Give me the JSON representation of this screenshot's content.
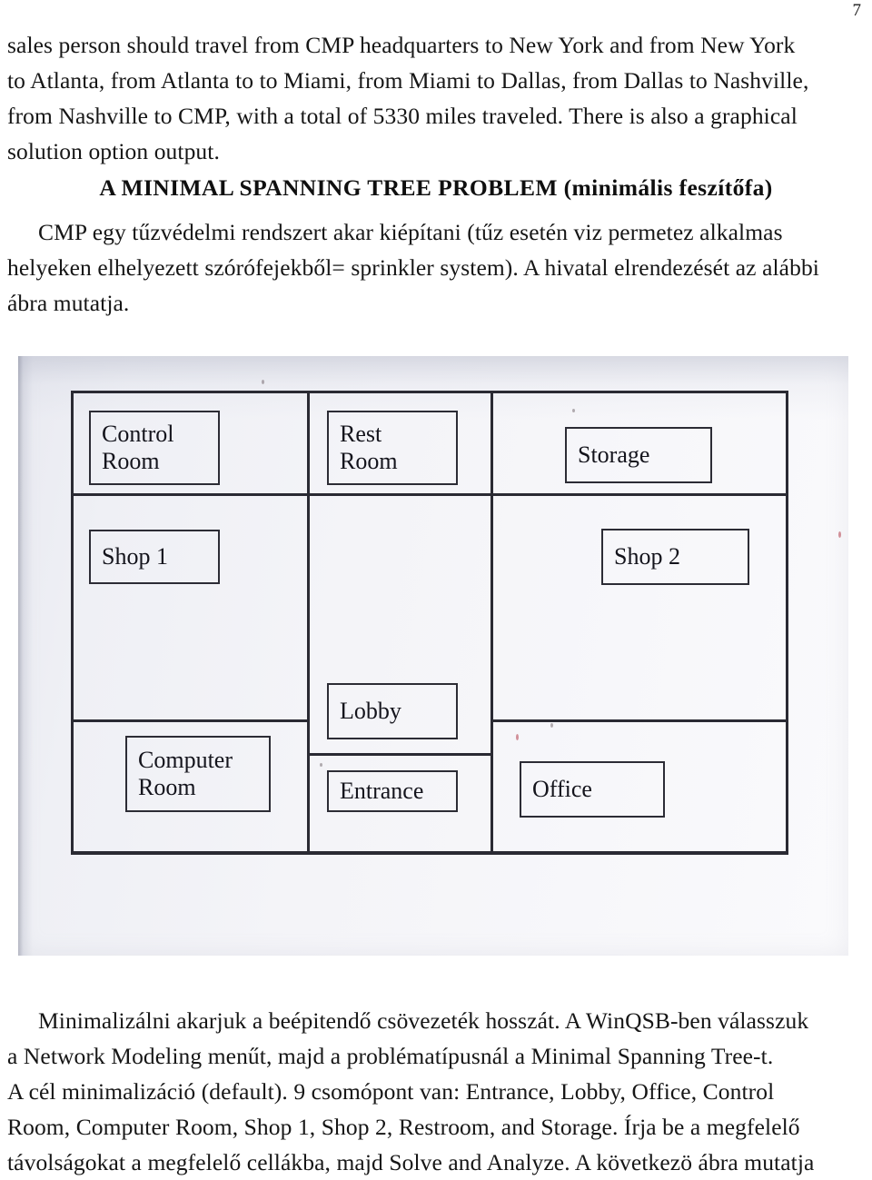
{
  "page": {
    "number": "7"
  },
  "paragraph_top": {
    "lines": [
      "sales person should travel from CMP headquarters to New York and from New York",
      "to Atlanta, from Atlanta to to Miami, from Miami to Dallas, from Dallas to Nashville,",
      "from Nashville to CMP, with a total of 5330 miles traveled. There is also a graphical",
      "solution option output."
    ]
  },
  "heading": {
    "text": "A MINIMAL SPANNING TREE PROBLEM (minimális feszítőfa)"
  },
  "paragraph_mid": {
    "lines": [
      "CMP egy tűzvédelmi rendszert akar kiépítani (tűz esetén viz permetez alkalmas",
      "helyeken elhelyezett szórófejekből= sprinkler system). A hivatal elrendezését az alábbi",
      "ábra mutatja."
    ]
  },
  "figure": {
    "caption": "",
    "floor_plan": {
      "rooms": [
        {
          "name": "control-room",
          "label": "Control\nRoom"
        },
        {
          "name": "rest-room",
          "label": "Rest\nRoom"
        },
        {
          "name": "storage",
          "label": "Storage"
        },
        {
          "name": "shop-1",
          "label": "Shop 1"
        },
        {
          "name": "shop-2",
          "label": "Shop 2"
        },
        {
          "name": "lobby",
          "label": "Lobby"
        },
        {
          "name": "computer-room",
          "label": "Computer\nRoom"
        },
        {
          "name": "entrance",
          "label": "Entrance"
        },
        {
          "name": "office",
          "label": "Office"
        }
      ]
    }
  },
  "paragraph_bottom": {
    "lines": [
      "Minimalizálni akarjuk a beépitendő csövezeték hosszát. A WinQSB-ben válasszuk",
      "a Network Modeling menűt, majd a problématípusnál a Minimal Spanning Tree-t.",
      "A cél minimalizáció (default). 9 csomópont van: Entrance, Lobby, Office, Control",
      "Room, Computer Room, Shop 1, Shop 2, Restroom, and Storage. Írja be a megfelelő",
      "távolságokat a megfelelő cellákba, majd Solve and Analyze. A következö ábra mutatja"
    ]
  }
}
